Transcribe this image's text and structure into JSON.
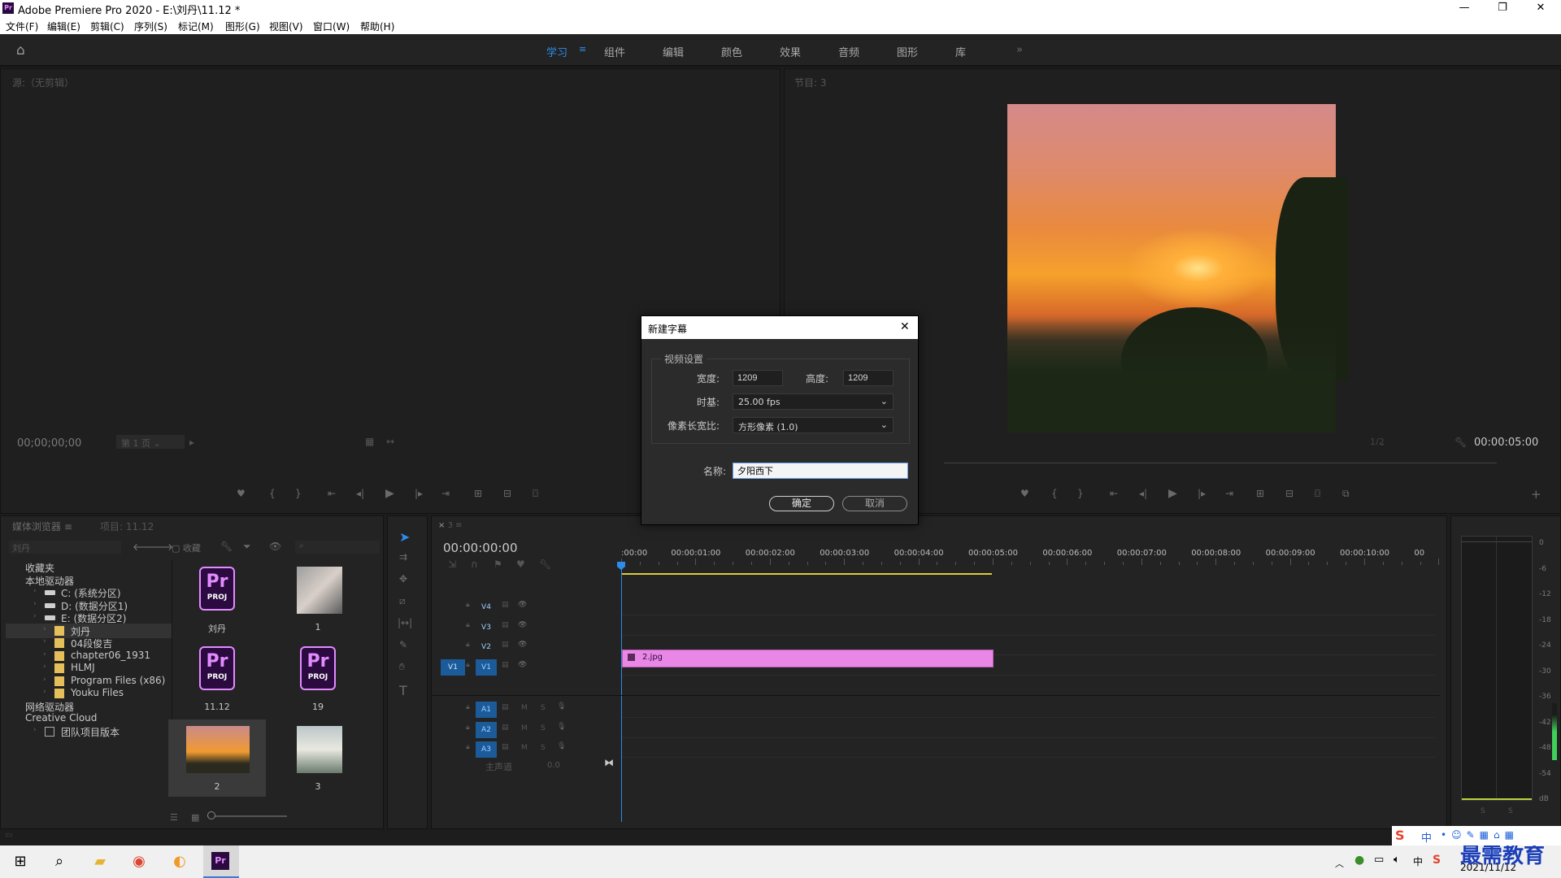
{
  "window": {
    "title": "Adobe Premiere Pro 2020 - E:\\刘丹\\11.12 *",
    "app_icon": "Pr",
    "minimize": "—",
    "maximize": "❐",
    "close": "✕"
  },
  "menu": [
    "文件(F)",
    "编辑(E)",
    "剪辑(C)",
    "序列(S)",
    "标记(M)",
    "图形(G)",
    "视图(V)",
    "窗口(W)",
    "帮助(H)"
  ],
  "workspaces": {
    "items": [
      "学习",
      "组件",
      "编辑",
      "颜色",
      "效果",
      "音频",
      "图形",
      "库"
    ],
    "active": "学习",
    "more": "»"
  },
  "source_monitor": {
    "title": "源:（无剪辑）",
    "timecode": "00;00;00;00",
    "page": "第 1 页"
  },
  "program_monitor": {
    "title": "节目: 3",
    "timecode": "00:00:05:00",
    "zoom": "1/2"
  },
  "media_browser": {
    "tab1": "媒体浏览器",
    "tab2": "项目: 11.12",
    "path": "刘丹",
    "favorites_label": "收藏",
    "tree": [
      {
        "label": "收藏夹",
        "indent": 0
      },
      {
        "label": "本地驱动器",
        "indent": 0
      },
      {
        "label": "C: (系统分区)",
        "indent": 2,
        "icon": "drive"
      },
      {
        "label": "D: (数据分区1)",
        "indent": 2,
        "icon": "drive"
      },
      {
        "label": "E: (数据分区2)",
        "indent": 2,
        "icon": "drive"
      },
      {
        "label": "刘丹",
        "indent": 3,
        "icon": "folder",
        "selected": true
      },
      {
        "label": "04段俊吉",
        "indent": 3,
        "icon": "folder"
      },
      {
        "label": "chapter06_1931",
        "indent": 3,
        "icon": "folder"
      },
      {
        "label": "HLMJ",
        "indent": 3,
        "icon": "folder"
      },
      {
        "label": "Program Files (x86)",
        "indent": 3,
        "icon": "folder"
      },
      {
        "label": "Youku Files",
        "indent": 3,
        "icon": "folder"
      },
      {
        "label": "网络驱动器",
        "indent": 0
      },
      {
        "label": "Creative Cloud",
        "indent": 0
      },
      {
        "label": "团队项目版本",
        "indent": 2,
        "icon": "team"
      }
    ],
    "items": [
      {
        "label": "刘丹",
        "kind": "prproj"
      },
      {
        "label": "1",
        "kind": "photo-hands"
      },
      {
        "label": "11.12",
        "kind": "prproj"
      },
      {
        "label": "19",
        "kind": "prproj"
      },
      {
        "label": "2",
        "kind": "photo-sunset",
        "selected": true
      },
      {
        "label": "3",
        "kind": "photo-drink"
      }
    ],
    "proj_badge": {
      "pr": "Pr",
      "proj": "PROJ"
    }
  },
  "timeline": {
    "tab": "3",
    "timecode": "00:00:00:00",
    "ruler": [
      ":00:00",
      "00:00:01:00",
      "00:00:02:00",
      "00:00:03:00",
      "00:00:04:00",
      "00:00:05:00",
      "00:00:06:00",
      "00:00:07:00",
      "00:00:08:00",
      "00:00:09:00",
      "00:00:10:00",
      "00"
    ],
    "video_tracks": [
      "V4",
      "V3",
      "V2",
      "V1"
    ],
    "audio_tracks": [
      "A1",
      "A2",
      "A3"
    ],
    "source_patch": "V1",
    "master": "主声道",
    "master_value": "0.0",
    "clip": {
      "name": "2.jpg",
      "track": "V1"
    },
    "mute": "M",
    "solo": "S"
  },
  "meter": {
    "scale": [
      "0",
      "-6",
      "-12",
      "-18",
      "-24",
      "-30",
      "-36",
      "-42",
      "-48",
      "-54",
      "dB"
    ],
    "solo1": "S",
    "solo2": "S"
  },
  "dialog": {
    "title": "新建字幕",
    "group": "视频设置",
    "width_label": "宽度:",
    "width": "1209",
    "height_label": "高度:",
    "height": "1209",
    "timebase_label": "时基:",
    "timebase": "25.00 fps",
    "par_label": "像素长宽比:",
    "par": "方形像素 (1.0)",
    "name_label": "名称:",
    "name": "夕阳西下",
    "ok": "确定",
    "cancel": "取消",
    "close": "✕"
  },
  "taskbar": {
    "ime": "中",
    "date": "2021/11/12",
    "watermark": "最需教育"
  }
}
